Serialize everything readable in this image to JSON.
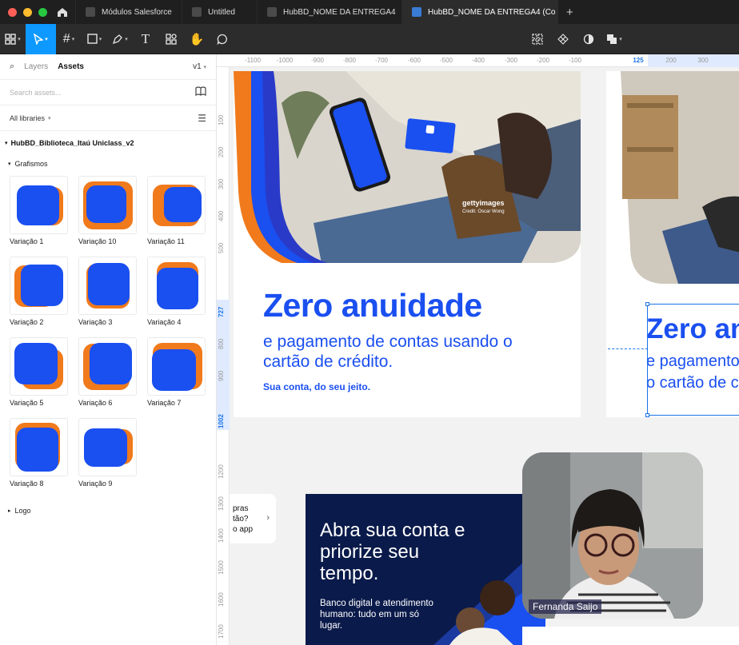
{
  "tabs": [
    {
      "label": "Módulos Salesforce",
      "active": false
    },
    {
      "label": "Untitled",
      "active": false
    },
    {
      "label": "HubBD_NOME DA ENTREGA4",
      "active": false
    },
    {
      "label": "HubBD_NOME DA ENTREGA4 (Co",
      "active": true
    }
  ],
  "toolbar": {
    "tools": [
      "main-menu",
      "move",
      "frame",
      "shape",
      "pen",
      "text",
      "resources",
      "hand",
      "comment"
    ],
    "right_tools": [
      "grid-icon",
      "component-icon",
      "contrast-icon",
      "boolean-icon"
    ]
  },
  "panel": {
    "tab_layers": "Layers",
    "tab_assets": "Assets",
    "version": "v1",
    "search_placeholder": "Search assets...",
    "libraries": "All libraries",
    "library_name": "HubBD_Biblioteca_Itaú Uniclass_v2",
    "group_name": "Grafismos",
    "assets": [
      "Variação 1",
      "Variação 10",
      "Variação 11",
      "Variação 2",
      "Variação 3",
      "Variação 4",
      "Variação 5",
      "Variação 6",
      "Variação 7",
      "Variação 8",
      "Variação 9"
    ],
    "logo_group": "Logo"
  },
  "rulers": {
    "top": [
      "-1100",
      "-1000",
      "-900",
      "-800",
      "-700",
      "-600",
      "-500",
      "-400",
      "-300",
      "-200",
      "-100",
      "125",
      "200",
      "300"
    ],
    "left": [
      "100",
      "200",
      "300",
      "400",
      "500",
      "727",
      "800",
      "900",
      "1002",
      "1200",
      "1300",
      "1400",
      "1500",
      "1600",
      "1700"
    ]
  },
  "artboard1": {
    "photo_credit": "gettyimages",
    "photo_credit_sub": "Credit: Oscar Wong",
    "headline": "Zero anuidade",
    "subline": "e pagamento de contas usando o cartão de crédito.",
    "tagline": "Sua conta, do seu jeito."
  },
  "artboard2": {
    "headline": "Zero an",
    "subline_1": "e pagamento",
    "subline_2": "o cartão de c"
  },
  "side_card": {
    "line1": "pras",
    "line2": "tão?",
    "line3": "o app"
  },
  "banner": {
    "headline": "Abra sua conta e priorize seu tempo.",
    "sub": "Banco digital e atendimento humano: tudo em um só lugar."
  },
  "video": {
    "participant": "Fernanda Saijo"
  },
  "colors": {
    "brand_blue": "#1a4ff0",
    "brand_orange": "#f07a1c",
    "accent": "#0d99ff"
  }
}
